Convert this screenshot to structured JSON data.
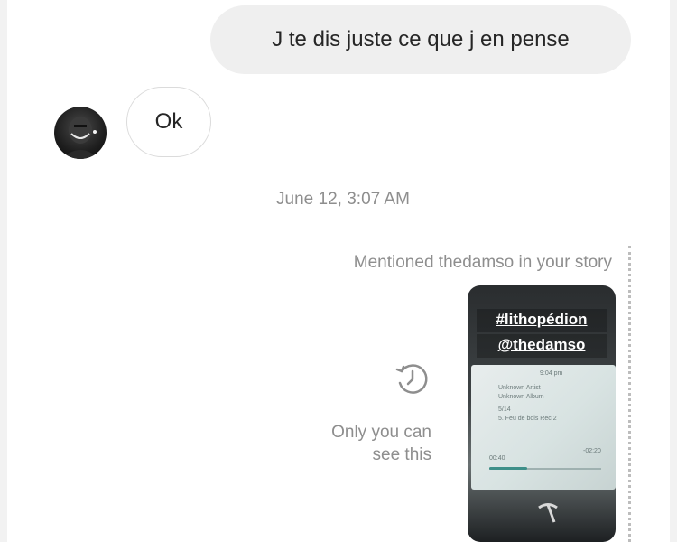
{
  "messages": {
    "outgoing_text": "J te dis juste ce que j en pense",
    "incoming_text": "Ok"
  },
  "timestamp": "June 12, 3:07 AM",
  "story_reply": {
    "mention_text": "Mentioned thedamso in your story",
    "tags": [
      "#lithopédion",
      "@thedamso"
    ],
    "screen": {
      "time": "9:04 pm",
      "artist": "Unknown Artist",
      "album": "Unknown Album",
      "track_num": "5/14",
      "track_title": "5. Feu de bois Rec 2",
      "elapsed": "00:40",
      "remaining": "-02:20"
    },
    "privacy_line1": "Only you can",
    "privacy_line2": "see this"
  },
  "colors": {
    "outgoing_bubble": "#efefef",
    "meta_text": "#8e8e8e",
    "text": "#262626"
  }
}
